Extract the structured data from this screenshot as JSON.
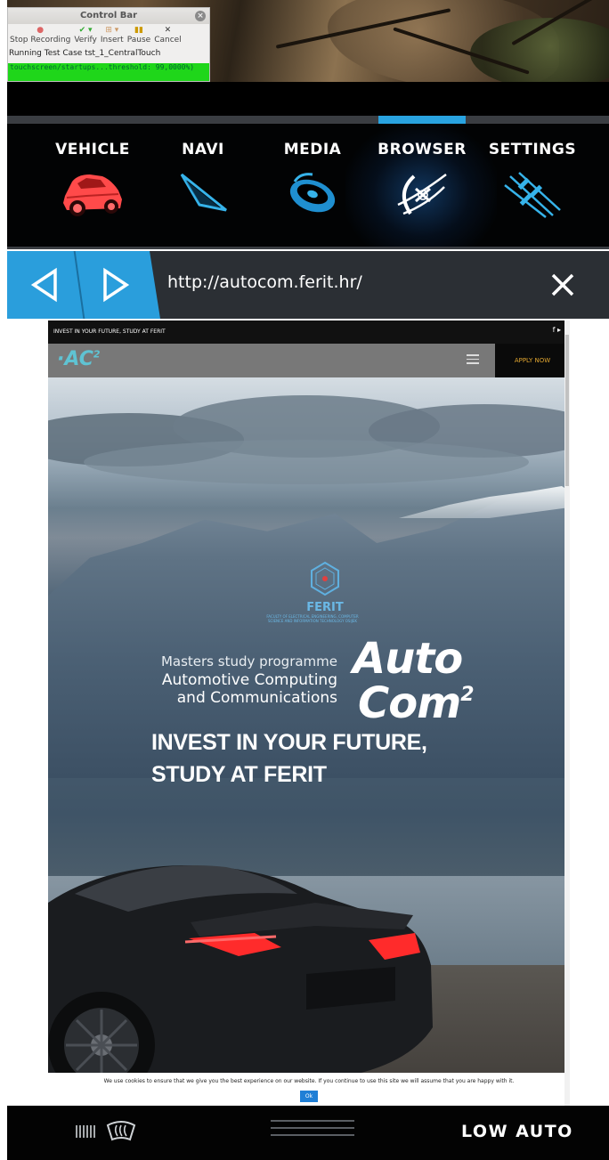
{
  "control_bar": {
    "title": "Control Bar",
    "close_icon": "×",
    "tools": [
      {
        "label": "Stop Recording",
        "icon": "record-icon"
      },
      {
        "label": "Verify",
        "icon": "check-icon"
      },
      {
        "label": "Insert",
        "icon": "insert-icon"
      },
      {
        "label": "Pause",
        "icon": "pause-icon"
      },
      {
        "label": "Cancel",
        "icon": "cancel-icon"
      }
    ],
    "status": "Running Test Case tst_1_CentralTouch",
    "log": "touchscreen/startups...threshold: 99,0000%)"
  },
  "tabs": [
    {
      "label": "VEHICLE",
      "icon": "car-icon",
      "color": "#ff4a4a"
    },
    {
      "label": "NAVI",
      "icon": "navigation-arrow-icon",
      "color": "#36b3ea"
    },
    {
      "label": "MEDIA",
      "icon": "media-disc-icon",
      "color": "#36b3ea"
    },
    {
      "label": "BROWSER",
      "icon": "browser-globe-icon",
      "color": "#ffffff"
    },
    {
      "label": "SETTINGS",
      "icon": "settings-sliders-icon",
      "color": "#36b3ea"
    }
  ],
  "active_tab": "BROWSER",
  "url_bar": {
    "url": "http://autocom.ferit.hr/",
    "accent": "#2a9edc"
  },
  "website": {
    "top_text": "INVEST IN YOUR FUTURE, STUDY AT FERIT",
    "social": "f  ▸",
    "logo_text": "AC",
    "logo_sup": "2",
    "apply": "APPLY NOW",
    "ferit_name": "FERIT",
    "ferit_sub": "FACULTY OF ELECTRICAL ENGINEERING, COMPUTER SCIENCE AND INFORMATION TECHNOLOGY OSIJEK",
    "masters": "Masters study programme",
    "programme_line1": "Automotive Computing",
    "programme_line2": "and Communications",
    "auto": "Auto",
    "com": "Com",
    "com_sup": "2",
    "invest_line1": "INVEST IN YOUR FUTURE,",
    "invest_line2": "STUDY AT FERIT",
    "cookie_msg": "We use cookies to ensure that we give you the best experience on our website. If you continue to use this site we will assume that you are happy with it.",
    "cookie_ok": "Ok"
  },
  "bottom_bar": {
    "climate_text": "LOW AUTO",
    "icons": [
      "rear-defrost-icon",
      "front-defrost-icon"
    ]
  }
}
